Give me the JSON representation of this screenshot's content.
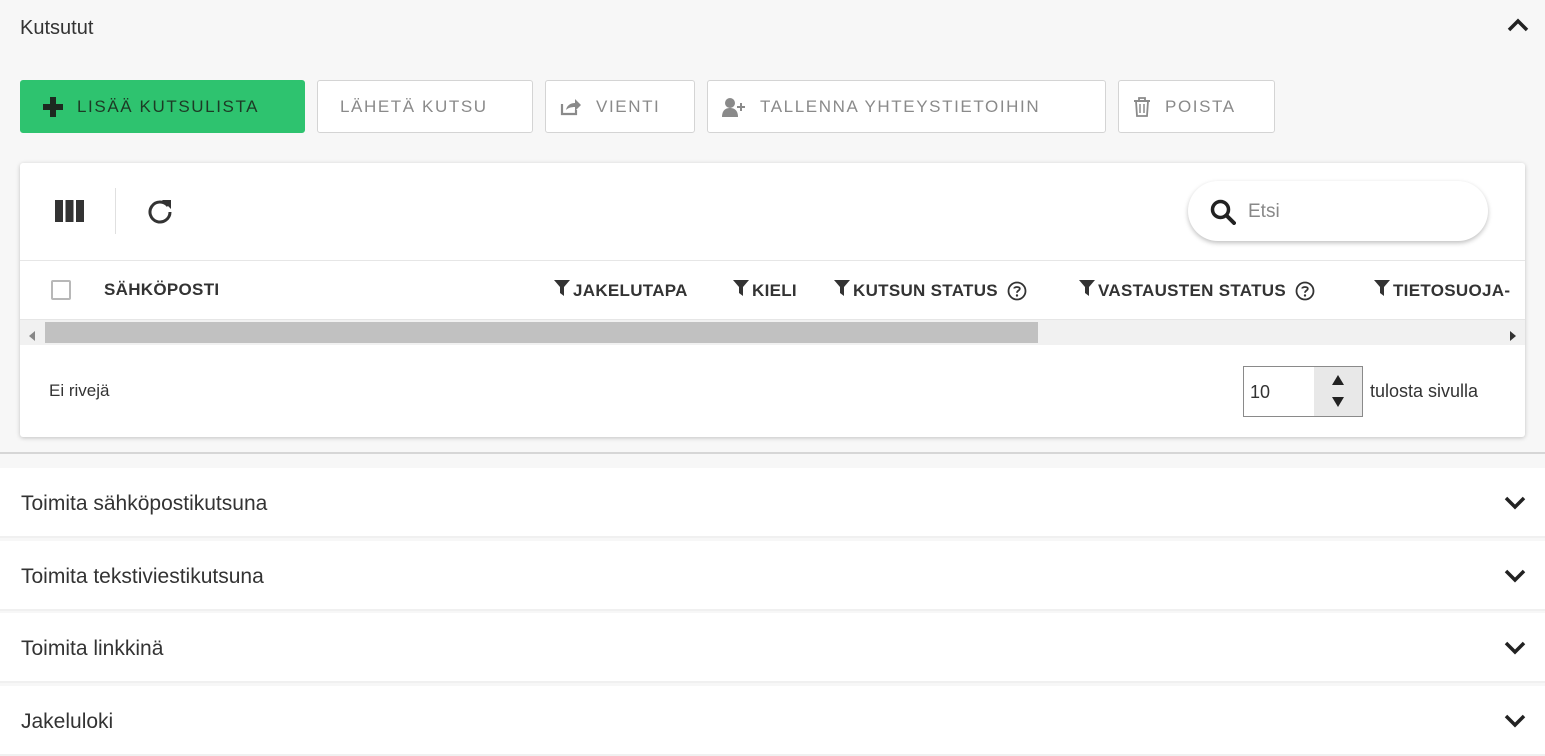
{
  "section": {
    "title": "Kutsutut",
    "toolbar": {
      "add_list": "LISÄÄ KUTSULISTA",
      "send_invite": "LÄHETÄ KUTSU",
      "export": "VIENTI",
      "save_contacts": "TALLENNA YHTEYSTIETOIHIN",
      "delete": "POISTA"
    },
    "table": {
      "search_placeholder": "Etsi",
      "columns": {
        "email": "SÄHKÖPOSTI",
        "delivery": "JAKELUTAPA",
        "language": "KIELI",
        "invite_status": "KUTSUN STATUS",
        "response_status": "VASTAUSTEN STATUS",
        "privacy": "TIETOSUOJA-"
      },
      "empty_text": "Ei rivejä",
      "page_size": "10",
      "page_size_label": "tulosta sivulla"
    }
  },
  "accordion": [
    {
      "label": "Toimita sähköpostikutsuna"
    },
    {
      "label": "Toimita tekstiviestikutsuna"
    },
    {
      "label": "Toimita linkkinä"
    },
    {
      "label": "Jakeluloki"
    }
  ],
  "colors": {
    "primary": "#2ec36f",
    "text": "#333333",
    "muted": "#8a8a8a"
  },
  "icons": [
    "plus-icon",
    "share-icon",
    "user-plus-icon",
    "trash-icon",
    "columns-icon",
    "refresh-icon",
    "search-icon",
    "filter-icon",
    "help-icon",
    "chevron-up-icon",
    "chevron-down-icon"
  ]
}
